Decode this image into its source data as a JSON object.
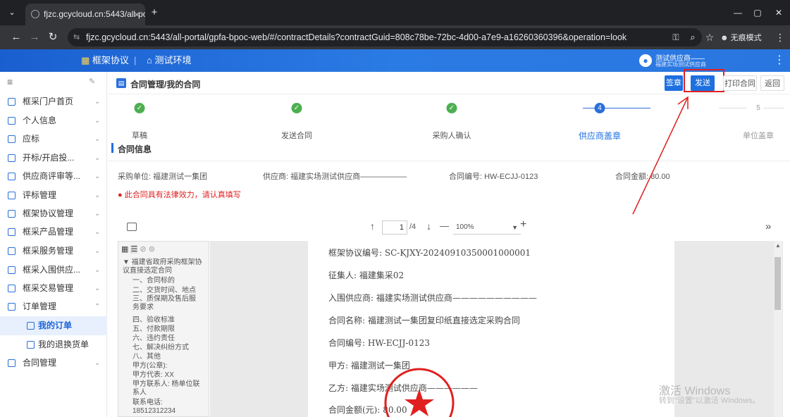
{
  "browser": {
    "tab_title": "fjzc.gcycloud.cn:5443/all-por",
    "tab_close": "×",
    "new_tab": "+",
    "url": "fjzc.gcycloud.cn:5443/all-portal/gpfa-bpoc-web/#/contractDetails?contractGuid=808c78be-72bc-4d00-a7e9-a16260360396&operation=look",
    "incognito_label": "无痕模式",
    "window_min": "—",
    "window_max": "▢",
    "window_close": "✕"
  },
  "app_header": {
    "nav_framework": "框架协议",
    "nav_env": "测试环境",
    "user_name": "测试供应商——",
    "user_org": "福建实场测试供应商"
  },
  "sidebar": {
    "items": [
      {
        "label": "框采门户首页",
        "arrow": "⌄"
      },
      {
        "label": "个人信息",
        "arrow": "⌄"
      },
      {
        "label": "应标",
        "arrow": "⌄"
      },
      {
        "label": "开标/开启投...",
        "arrow": "⌄"
      },
      {
        "label": "供应商评审等...",
        "arrow": "⌄"
      },
      {
        "label": "评标管理",
        "arrow": "⌄"
      },
      {
        "label": "框架协议管理",
        "arrow": "⌄"
      },
      {
        "label": "框采产品管理",
        "arrow": "⌄"
      },
      {
        "label": "框采服务管理",
        "arrow": "⌄"
      },
      {
        "label": "框采入围供应...",
        "arrow": "⌄"
      },
      {
        "label": "框采交易管理",
        "arrow": "⌄"
      },
      {
        "label": "订单管理",
        "arrow": "⌃"
      },
      {
        "label": "我的订单",
        "arrow": ""
      },
      {
        "label": "我的退换货单",
        "arrow": ""
      },
      {
        "label": "合同管理",
        "arrow": "⌄"
      }
    ]
  },
  "page": {
    "title": "合同管理/我的合同",
    "buttons": {
      "sign": "签章",
      "send": "发送",
      "print": "打印合同",
      "back": "返回"
    },
    "steps": [
      {
        "label": "草稿",
        "status": "done"
      },
      {
        "label": "发送合同",
        "status": "done"
      },
      {
        "label": "采购人确认",
        "status": "done"
      },
      {
        "label": "供应商盖章",
        "status": "current",
        "num": "4"
      },
      {
        "label": "单位盖章",
        "status": "pending",
        "num": "5"
      }
    ],
    "section_title": "合同信息",
    "info": {
      "purchaser": "采购单位: 福建测试一集团",
      "supplier": "供应商: 福建实场测试供应商——————",
      "contract_no": "合同编号: HW-ECJJ-0123",
      "amount": "合同金额: 80.00"
    },
    "warning": "此合同具有法律效力，请认真填写"
  },
  "pdf_viewer": {
    "page_current": "1",
    "page_total": "/4",
    "zoom": "100%",
    "minus": "—",
    "plus": "+",
    "expand": "»",
    "outline": [
      "▼ 福建省政府采购框架协议直接选定合同",
      "一、合同标的",
      "二、交货时间、地点",
      "三、质保期及售后服务要求",
      "四、验收标准",
      "五、付款期限",
      "六、违约责任",
      "七、解决纠纷方式",
      "八、其他",
      "甲方(公章):",
      "甲方代表: XX",
      "甲方联系人: 杨单位联系人",
      "联系电话: 18512312234"
    ],
    "doc_lines": [
      "框架协议编号: SC-KJXY-20240910350001000001",
      "征集人: 福建集采02",
      "入围供应商: 福建实场测试供应商——————————",
      "合同名称: 福建测试一集团复印纸直接选定采购合同",
      "合同编号: HW-ECJJ-0123",
      "甲方: 福建测试一集团",
      "乙方: 福建实场测试供应商——————",
      "合同金额(元): 80.00"
    ],
    "stamp_text": "软件服务有限公司"
  },
  "watermark": {
    "line1": "激活 Windows",
    "line2": "转到\"设置\"以激活 Windows。"
  },
  "colors": {
    "accent": "#1e6fe0",
    "success": "#4caf50",
    "warning": "#e02020",
    "annotation": "#e02020"
  }
}
